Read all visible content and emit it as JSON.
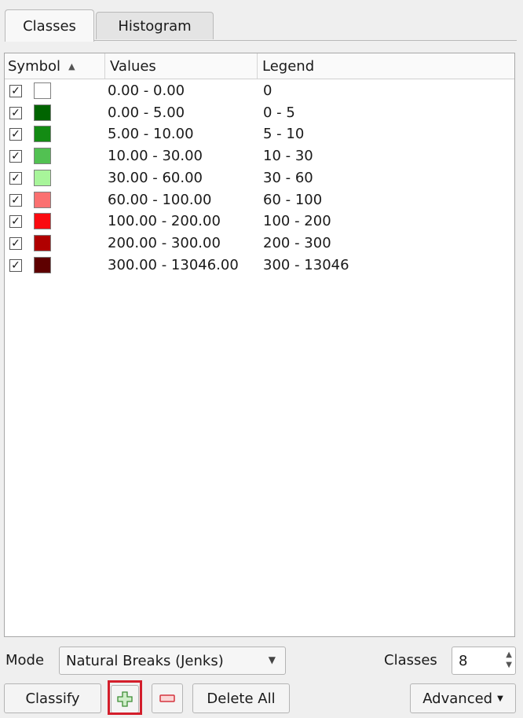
{
  "tabs": [
    {
      "label": "Classes"
    },
    {
      "label": "Histogram"
    }
  ],
  "table": {
    "headers": {
      "symbol": "Symbol",
      "values": "Values",
      "legend": "Legend"
    },
    "rows": [
      {
        "checked": "✓",
        "color": "#ffffff",
        "values": "0.00 - 0.00",
        "legend": "0"
      },
      {
        "checked": "✓",
        "color": "#006400",
        "values": "0.00 - 5.00",
        "legend": "0 - 5"
      },
      {
        "checked": "✓",
        "color": "#138b13",
        "values": "5.00 - 10.00",
        "legend": "5 - 10"
      },
      {
        "checked": "✓",
        "color": "#52c152",
        "values": "10.00 - 30.00",
        "legend": "10 - 30"
      },
      {
        "checked": "✓",
        "color": "#a8f59a",
        "values": "30.00 - 60.00",
        "legend": "30 - 60"
      },
      {
        "checked": "✓",
        "color": "#fb7070",
        "values": "60.00 - 100.00",
        "legend": "60 - 100"
      },
      {
        "checked": "✓",
        "color": "#fa0a10",
        "values": "100.00 - 200.00",
        "legend": "100 - 200"
      },
      {
        "checked": "✓",
        "color": "#b00000",
        "values": "200.00 - 300.00",
        "legend": "200 - 300"
      },
      {
        "checked": "✓",
        "color": "#5e0000",
        "values": "300.00 - 13046.00",
        "legend": "300 - 13046"
      }
    ]
  },
  "mode": {
    "label": "Mode",
    "value": "Natural Breaks (Jenks)"
  },
  "classes": {
    "label": "Classes",
    "value": "8"
  },
  "buttons": {
    "classify": "Classify",
    "add_icon": "+",
    "remove_icon": "−",
    "delete_all": "Delete All",
    "advanced": "Advanced"
  }
}
